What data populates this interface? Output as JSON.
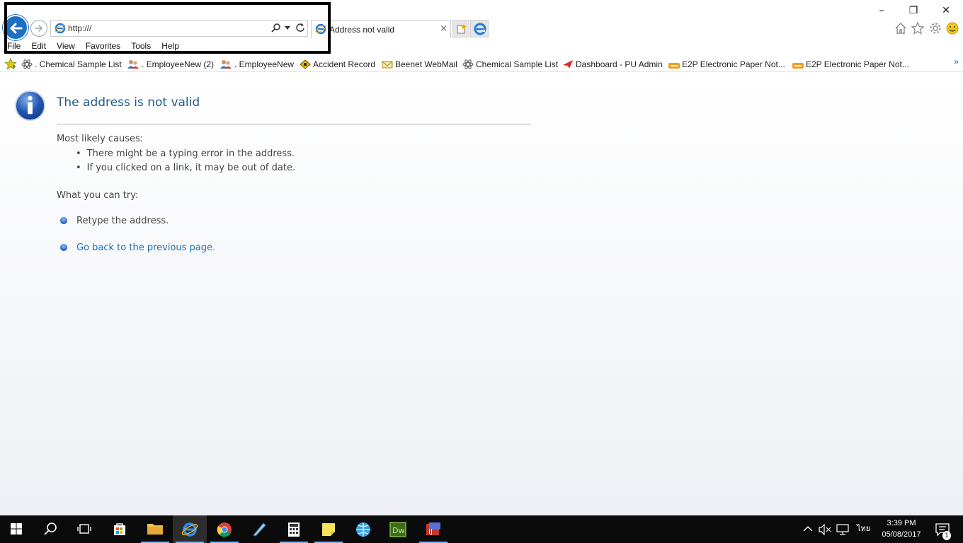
{
  "browser": {
    "address": {
      "value": "http:///"
    },
    "tab": {
      "title": "Address not valid",
      "close_glyph": "×"
    },
    "window_controls": {
      "minimize": "–",
      "restore": "❐",
      "close": "✕"
    },
    "menu": [
      "File",
      "Edit",
      "View",
      "Favorites",
      "Tools",
      "Help"
    ],
    "favorites": [
      {
        "label": ". Chemical Sample List",
        "icon": "atom-icon"
      },
      {
        "label": ". EmployeeNew  (2)",
        "icon": "people-icon"
      },
      {
        "label": ". EmployeeNew",
        "icon": "people-icon"
      },
      {
        "label": "Accident Record",
        "icon": "record-icon"
      },
      {
        "label": "Beenet WebMail",
        "icon": "mail-icon"
      },
      {
        "label": "Chemical Sample List",
        "icon": "atom-icon"
      },
      {
        "label": "Dashboard - PU Admin",
        "icon": "paper-plane-icon"
      },
      {
        "label": "E2P  Electronic Paper Not...",
        "icon": "e2p-icon"
      },
      {
        "label": "E2P  Electronic Paper Not...",
        "icon": "e2p-icon"
      }
    ],
    "favorites_more": "»"
  },
  "page": {
    "title": "The address is not valid",
    "causes_heading": "Most likely causes:",
    "causes": [
      "There might be a typing error in the address.",
      "If you clicked on a link, it may be out of date."
    ],
    "try_heading": "What you can try:",
    "try_items": [
      {
        "text": "Retype the address.",
        "link": false
      },
      {
        "text": "Go back to the previous page.",
        "link": true
      }
    ]
  },
  "taskbar": {
    "clock_time": "3:39 PM",
    "clock_date": "05/08/2017",
    "language": "ไทย",
    "notification_count": "1"
  },
  "colors": {
    "accent": "#1d6fc5",
    "title": "#1f5a8c",
    "link": "#1a6fb0",
    "taskbar": "#0b0b0b"
  }
}
